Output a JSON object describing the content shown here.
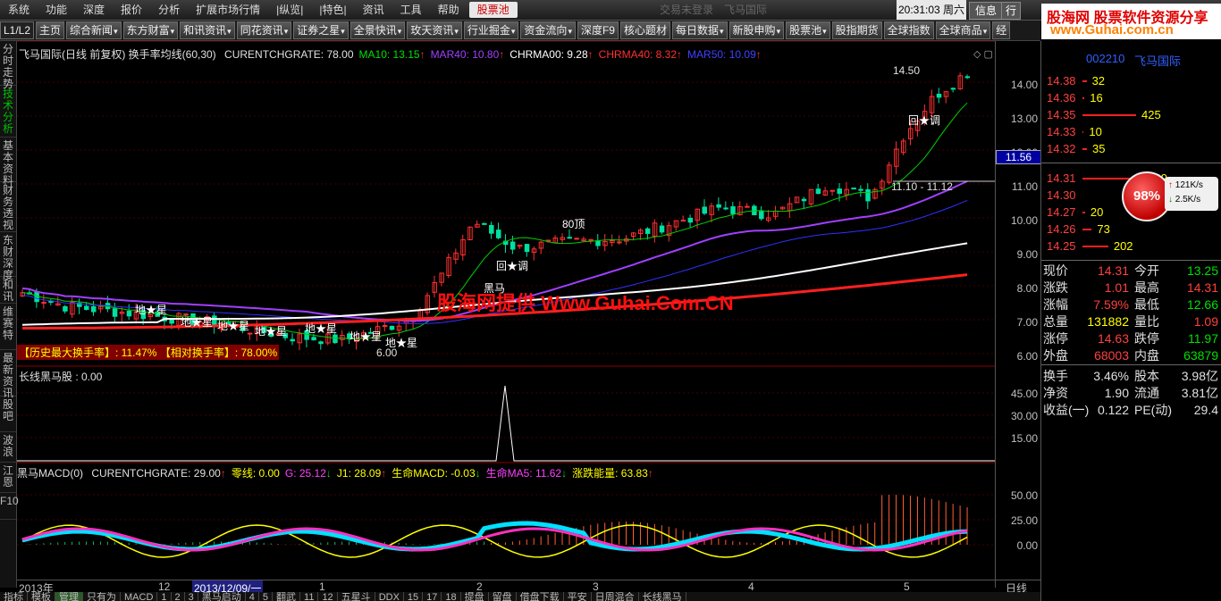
{
  "menu": {
    "items": [
      "系统",
      "功能",
      "深度",
      "报价",
      "分析",
      "扩展市场行情",
      "|纵览|",
      "|特色|",
      "资讯",
      "工具",
      "帮助"
    ],
    "highlight": "股票池",
    "login": "交易未登录",
    "stock_top": "飞马国际",
    "clock": "20:31:03 周六",
    "news": "信息",
    "more": "行"
  },
  "toolbar": {
    "level": "L1/L2",
    "items": [
      {
        "label": "主页",
        "dd": false
      },
      {
        "label": "综合新闻",
        "dd": true
      },
      {
        "label": "东方财富",
        "dd": true
      },
      {
        "label": "和讯资讯",
        "dd": true
      },
      {
        "label": "同花资讯",
        "dd": true
      },
      {
        "label": "证券之星",
        "dd": true
      },
      {
        "label": "全景快讯",
        "dd": true
      },
      {
        "label": "玫天资讯",
        "dd": true
      },
      {
        "label": "行业掘金",
        "dd": true
      },
      {
        "label": "资金流向",
        "dd": true
      },
      {
        "label": "深度F9",
        "dd": false
      },
      {
        "label": "核心题材",
        "dd": false
      },
      {
        "label": "每日数据",
        "dd": true
      },
      {
        "label": "新股申购",
        "dd": true
      },
      {
        "label": "股票池",
        "dd": true
      },
      {
        "label": "股指期货",
        "dd": false
      },
      {
        "label": "全球指数",
        "dd": false
      },
      {
        "label": "全球商品",
        "dd": true
      },
      {
        "label": "经",
        "dd": false
      }
    ]
  },
  "left_tabs": [
    {
      "label": "分时走势",
      "active": false
    },
    {
      "label": "技术分析",
      "active": true
    },
    {
      "label": "基本资料",
      "active": false
    },
    {
      "label": "财务透视",
      "active": false
    },
    {
      "label": "东财深度",
      "active": false
    },
    {
      "label": "和讯",
      "active": false
    },
    {
      "label": "维赛特",
      "active": false
    },
    {
      "label": "最新资讯",
      "active": false
    },
    {
      "label": "股吧",
      "active": false
    },
    {
      "label": "波浪",
      "active": false
    },
    {
      "label": "江恩",
      "active": false
    },
    {
      "label": "F10",
      "active": false
    }
  ],
  "main_legend": {
    "title": "飞马国际(日线 前复权) 换手率均线(60,30)",
    "items": [
      {
        "text": "CURENTCHGRATE: 78.00",
        "color": "#e0e0e0"
      },
      {
        "text": "MA10: 13.15",
        "color": "#00e000",
        "arrow": "↑"
      },
      {
        "text": "MAR40: 10.80",
        "color": "#a040ff",
        "arrow": "↑"
      },
      {
        "text": "CHRMA00: 9.28",
        "color": "#ffffff",
        "arrow": "↑"
      },
      {
        "text": "CHRMA40: 8.32",
        "color": "#ff3030",
        "arrow": "↑"
      },
      {
        "text": "MAR50: 10.09",
        "color": "#4040ff",
        "arrow": "↑"
      }
    ]
  },
  "annotations": {
    "high": "14.50",
    "low": "6.00",
    "range": "11.10 - 11.12",
    "top80": "80顶",
    "callback": "回★调",
    "blackhorse": "黑马",
    "star": "地★星",
    "turnover_max": "【历史最大换手率】: 11.47%",
    "turnover_rel": "【相对换手率】: 78.00%",
    "watermark": "股海网提供 Www.Guhai.Com.CN"
  },
  "main_axis": [
    "14.00",
    "13.00",
    "12.00",
    "11.00",
    "10.00",
    "9.00",
    "8.00",
    "7.00",
    "6.00"
  ],
  "crosshair_value": "11.56",
  "sub1": {
    "title": "长线黑马股 : 0.00",
    "axis": [
      "45.00",
      "30.00",
      "15.00"
    ]
  },
  "sub2": {
    "title": "黑马MACD(0)",
    "items": [
      {
        "text": "CURENTCHGRATE: 29.00",
        "color": "#e0e0e0",
        "arrow": "↑"
      },
      {
        "text": "零线: 0.00",
        "color": "#ffff00"
      },
      {
        "text": "G: 25.12",
        "color": "#ff40ff",
        "arrow": "↓"
      },
      {
        "text": "J1: 28.09",
        "color": "#ffff00",
        "arrow": "↑"
      },
      {
        "text": "生命MACD: -0.03",
        "color": "#ffff00",
        "arrow": "↓"
      },
      {
        "text": "生命MA5: 11.62",
        "color": "#ff40ff",
        "arrow": "↓"
      },
      {
        "text": "涨跌能量: 63.83",
        "color": "#ffff00",
        "arrow": "↑"
      }
    ],
    "axis": [
      "50.00",
      "25.00",
      "0.00"
    ]
  },
  "xaxis": {
    "labels": [
      "2013年",
      "12",
      "2013/12/09/一",
      "1",
      "2",
      "3",
      "4",
      "5"
    ],
    "right": "日线"
  },
  "bottom_tabs": [
    "指标",
    "模板",
    "管理",
    "只有为",
    "MACD",
    "1",
    "2",
    "3",
    "黑马启动",
    "4",
    "5",
    "翻武",
    "11",
    "12",
    "五星斗",
    "DDX",
    "15",
    "17",
    "18",
    "提盘",
    "留盘",
    "借盘下载",
    "平安",
    "日周混合",
    "长线黑马"
  ],
  "quote": {
    "brand": "股海网 股票软件资源分享",
    "brand_url": "www.Guhai.com.cn",
    "code": "002210",
    "name": "飞马国际",
    "sell": [
      {
        "p": "14.38",
        "v": "32"
      },
      {
        "p": "14.36",
        "v": "16"
      },
      {
        "p": "14.35",
        "v": "425"
      },
      {
        "p": "14.33",
        "v": "10"
      },
      {
        "p": "14.32",
        "v": "35"
      }
    ],
    "buy": [
      {
        "p": "14.31",
        "v": "1869"
      },
      {
        "p": "14.30",
        "v": ""
      },
      {
        "p": "14.27",
        "v": "20"
      },
      {
        "p": "14.26",
        "v": "73"
      },
      {
        "p": "14.25",
        "v": "202"
      }
    ],
    "gauge": "98%",
    "up_speed": "121K/s",
    "down_speed": "2.5K/s",
    "stats": [
      {
        "l": "现价",
        "v": "14.31",
        "vc": "#ff4040",
        "l2": "今开",
        "v2": "13.25",
        "v2c": "#00e000"
      },
      {
        "l": "涨跌",
        "v": "1.01",
        "vc": "#ff4040",
        "l2": "最高",
        "v2": "14.31",
        "v2c": "#ff4040"
      },
      {
        "l": "涨幅",
        "v": "7.59%",
        "vc": "#ff4040",
        "l2": "最低",
        "v2": "12.66",
        "v2c": "#00e000"
      },
      {
        "l": "总量",
        "v": "131882",
        "vc": "#ffff00",
        "l2": "量比",
        "v2": "1.09",
        "v2c": "#ff4040"
      },
      {
        "l": "涨停",
        "v": "14.63",
        "vc": "#ff4040",
        "l2": "跌停",
        "v2": "11.97",
        "v2c": "#00e000"
      },
      {
        "l": "外盘",
        "v": "68003",
        "vc": "#ff4040",
        "l2": "内盘",
        "v2": "63879",
        "v2c": "#00e000"
      },
      {
        "l": "换手",
        "v": "3.46%",
        "vc": "#e0e0e0",
        "l2": "股本",
        "v2": "3.98亿",
        "v2c": "#e0e0e0"
      },
      {
        "l": "净资",
        "v": "1.90",
        "vc": "#e0e0e0",
        "l2": "流通",
        "v2": "3.81亿",
        "v2c": "#e0e0e0"
      },
      {
        "l": "收益(一)",
        "v": "0.122",
        "vc": "#e0e0e0",
        "l2": "PE(动)",
        "v2": "29.4",
        "v2c": "#e0e0e0"
      }
    ]
  }
}
